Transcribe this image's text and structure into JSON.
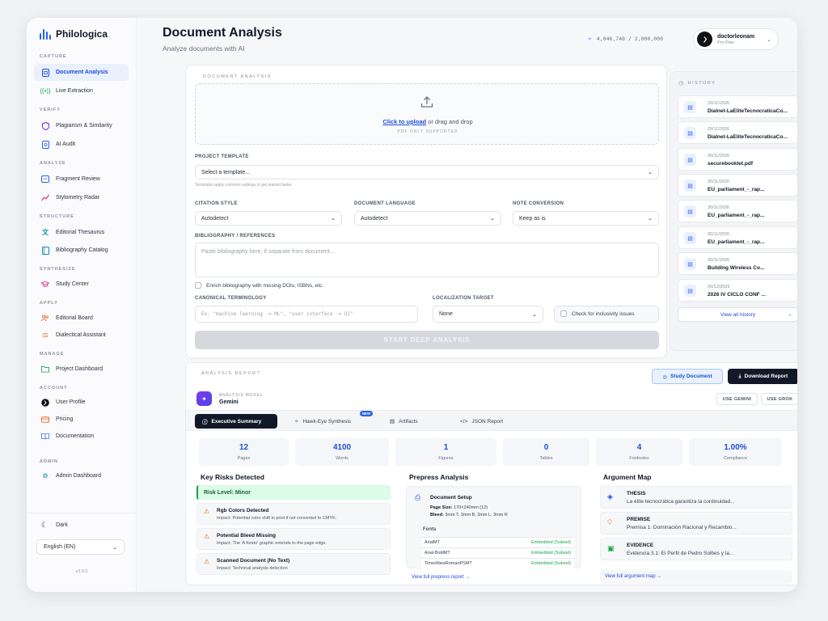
{
  "app": {
    "name": "Philologica",
    "version": "v3.0.0"
  },
  "sidebar": {
    "sections": [
      {
        "label": "CAPTURE",
        "items": [
          {
            "label": "Document Analysis",
            "icon": "document-scan-icon"
          },
          {
            "label": "Live Extraction",
            "icon": "broadcast-icon"
          }
        ]
      },
      {
        "label": "VERIFY",
        "items": [
          {
            "label": "Plagiarism & Similarity",
            "icon": "shield-icon"
          },
          {
            "label": "AI Audit",
            "icon": "audit-icon"
          }
        ]
      },
      {
        "label": "ANALYZE",
        "items": [
          {
            "label": "Fragment Review",
            "icon": "fragment-icon"
          },
          {
            "label": "Stylometry Radar",
            "icon": "chart-icon"
          }
        ]
      },
      {
        "label": "STRUCTURE",
        "items": [
          {
            "label": "Editorial Thesaurus",
            "icon": "translate-icon"
          },
          {
            "label": "Bibliography Catalog",
            "icon": "book-icon"
          }
        ]
      },
      {
        "label": "SYNTHESIZE",
        "items": [
          {
            "label": "Study Center",
            "icon": "graduation-cap-icon"
          }
        ]
      },
      {
        "label": "APPLY",
        "items": [
          {
            "label": "Editorial Board",
            "icon": "users-icon"
          },
          {
            "label": "Dialectical Assistant",
            "icon": "balance-icon"
          }
        ]
      },
      {
        "label": "MANAGE",
        "items": [
          {
            "label": "Project Dashboard",
            "icon": "folder-icon"
          }
        ]
      },
      {
        "label": "ACCOUNT",
        "items": [
          {
            "label": "User Profile",
            "icon": "user-icon"
          },
          {
            "label": "Pricing",
            "icon": "credit-card-icon"
          },
          {
            "label": "Documentation",
            "icon": "book-open-icon"
          }
        ]
      },
      {
        "label": "ADMIN",
        "items": [
          {
            "label": "Admin Dashboard",
            "icon": "gear-icon"
          }
        ]
      }
    ],
    "dark_label": "Dark",
    "language": "English (EN)"
  },
  "header": {
    "title": "Document Analysis",
    "subtitle": "Analyze documents with AI",
    "credits": "4,046,748 / 2,000,000",
    "user": {
      "name": "doctorleonam",
      "plan": "Pro Plan"
    }
  },
  "form": {
    "section_title": "DOCUMENT ANALYSIS",
    "upload": {
      "link": "Click to upload",
      "rest": " or drag and drop",
      "note": "PDF ONLY SUPPORTED"
    },
    "project_template": {
      "label": "PROJECT TEMPLATE",
      "value": "Select a template...",
      "hint": "Templates apply common settings to get started faster."
    },
    "citation_style": {
      "label": "CITATION STYLE",
      "value": "Autodetect"
    },
    "document_language": {
      "label": "DOCUMENT LANGUAGE",
      "value": "Autodetect"
    },
    "note_conversion": {
      "label": "NOTE CONVERSION",
      "value": "Keep as is"
    },
    "bibliography": {
      "label": "BIBLIOGRAPHY / REFERENCES",
      "placeholder": "Paste bibliography here, if separate from document..."
    },
    "enrich_label": "Enrich bibliography with missing DOIs, ISBNs, etc.",
    "canonical": {
      "label": "CANONICAL TERMINOLOGY",
      "placeholder": "Ex: \"machine learning -> ML\", \"user interface -> UI\""
    },
    "localization": {
      "label": "LOCALIZATION TARGET",
      "value": "None"
    },
    "inclusivity_label": "Check for inclusivity issues",
    "start_button": "START DEEP ANALYSIS"
  },
  "history": {
    "title": "HISTORY",
    "items": [
      {
        "date": "29/11/2026",
        "name": "Dialnet-LaEliteTecnocraticaCo..."
      },
      {
        "date": "29/11/2026",
        "name": "Dialnet-LaEliteTecnocraticaCo..."
      },
      {
        "date": "30/11/2026",
        "name": "securebooklet.pdf"
      },
      {
        "date": "30/11/2026",
        "name": "EU_parliament_-_rap..."
      },
      {
        "date": "30/11/2026",
        "name": "EU_parliament_-_rap..."
      },
      {
        "date": "30/11/2026",
        "name": "EU_parliament_-_rap..."
      },
      {
        "date": "30/11/2026",
        "name": "Building Wireless Co..."
      },
      {
        "date": "26/12/2026",
        "name": "2026 IV CICLO CONF ..."
      }
    ],
    "view_all": "View all history"
  },
  "report": {
    "title": "ANALYSIS REPORT",
    "study_button": "Study Document",
    "download_button": "Download Report",
    "model_label": "ANALYSIS MODEL",
    "model_name": "Gemini",
    "use_gemini": "USE GEMINI",
    "use_grok": "USE GROK",
    "tabs": [
      {
        "label": "Executive Summary"
      },
      {
        "label": "Hawk-Eye Synthesis"
      },
      {
        "label": "Artifacts"
      },
      {
        "label": "JSON Report"
      }
    ],
    "new_badge": "NEW",
    "stats": [
      {
        "value": "12",
        "label": "Pages"
      },
      {
        "value": "4100",
        "label": "Words"
      },
      {
        "value": "1",
        "label": "Figures"
      },
      {
        "value": "0",
        "label": "Tables"
      },
      {
        "value": "4",
        "label": "Footnotes"
      },
      {
        "value": "1.00%",
        "label": "Compliance"
      }
    ],
    "risks": {
      "title": "Key Risks Detected",
      "level": "Risk Level: Minor",
      "items": [
        {
          "title": "Rgb Colors Detected",
          "impact": "Impact: Potential color shift in print if not converted to CMYK."
        },
        {
          "title": "Potential Bleed Missing",
          "impact": "Impact: The 'A fondo' graphic extends to the page edge."
        },
        {
          "title": "Scanned Document (No Text)",
          "impact": "Impact: Technical analysis detection"
        }
      ]
    },
    "prepress": {
      "title": "Prepress Analysis",
      "setup_title": "Document Setup",
      "page_size_label": "Page Size:",
      "page_size": " 170×240mm (12)",
      "bleed_label": "Bleed:",
      "bleed": " 3mm T, 3mm B, 3mm L, 3mm R",
      "fonts_label": "Fonts",
      "fonts": [
        {
          "name": "ArialMT",
          "status": "Embedded (Subset)"
        },
        {
          "name": "Arial-BoldMT",
          "status": "Embedded (Subset)"
        },
        {
          "name": "TimesNewRomanPSMT",
          "status": "Embedded (Subset)"
        }
      ],
      "view_link": "View full prepress report →"
    },
    "argument": {
      "title": "Argument Map",
      "items": [
        {
          "title": "THESIS",
          "text": "La élite tecnocrática garantiza la continuidad...",
          "icon": "layers-icon",
          "color": "#1d4ed8"
        },
        {
          "title": "PREMISE",
          "text": "Premisa 1: Dominación Racional y Recambio...",
          "icon": "lightbulb-icon",
          "color": "#d97706"
        },
        {
          "title": "EVIDENCE",
          "text": "Evidencia 3.1: El Perfil de Pedro Solbes y la...",
          "icon": "evidence-icon",
          "color": "#16a34a"
        }
      ],
      "view_link": "View full argument map →"
    }
  }
}
